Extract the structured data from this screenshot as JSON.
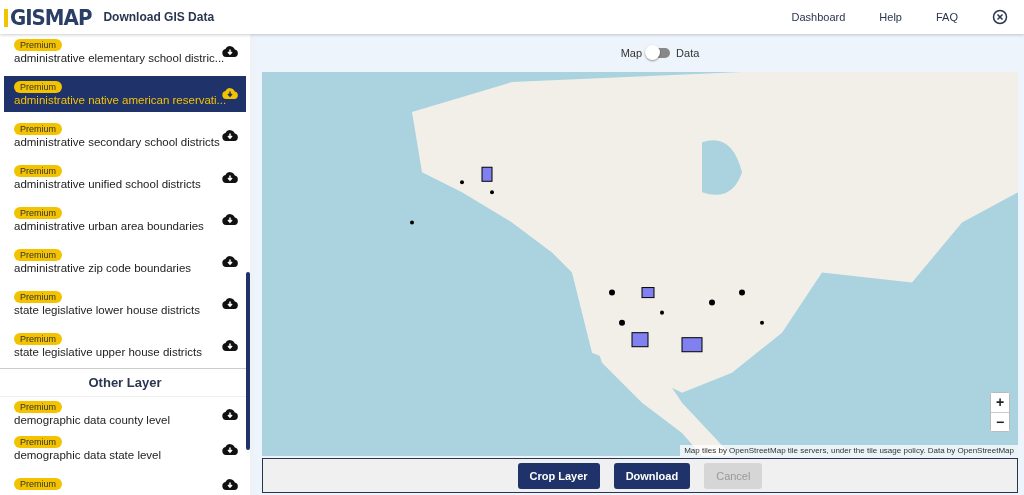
{
  "header": {
    "logo": "GISMAP",
    "title": "Download GIS Data",
    "nav": [
      "Dashboard",
      "Help",
      "FAQ"
    ]
  },
  "sidebar": {
    "groups": [
      {
        "items": [
          {
            "badge": "Premium",
            "name": "administrative elementary school distric...",
            "selected": false
          },
          {
            "badge": "Premium",
            "name": "administrative native american reservati...",
            "selected": true
          },
          {
            "badge": "Premium",
            "name": "administrative secondary school districts",
            "selected": false
          },
          {
            "badge": "Premium",
            "name": "administrative unified school districts",
            "selected": false
          },
          {
            "badge": "Premium",
            "name": "administrative urban area boundaries",
            "selected": false
          },
          {
            "badge": "Premium",
            "name": "administrative zip code boundaries",
            "selected": false
          },
          {
            "badge": "Premium",
            "name": "state legislative lower house districts",
            "selected": false
          },
          {
            "badge": "Premium",
            "name": "state legislative upper house districts",
            "selected": false
          }
        ]
      },
      {
        "heading": "Other Layer",
        "items": [
          {
            "badge": "Premium",
            "name": "demographic data county level",
            "selected": false
          },
          {
            "badge": "Premium",
            "name": "demographic data state level",
            "selected": false
          },
          {
            "badge": "Premium",
            "selected": false
          }
        ]
      }
    ]
  },
  "view_toggle": {
    "left": "Map",
    "right": "Data",
    "on": false
  },
  "map": {
    "zoom_in": "+",
    "zoom_out": "−",
    "attribution": "Map tiles by OpenStreetMap tile servers, under the tile usage policy. Data by OpenStreetMap"
  },
  "actions": [
    {
      "label": "Crop Layer",
      "disabled": false
    },
    {
      "label": "Download",
      "disabled": false
    },
    {
      "label": "Cancel",
      "disabled": true
    }
  ]
}
